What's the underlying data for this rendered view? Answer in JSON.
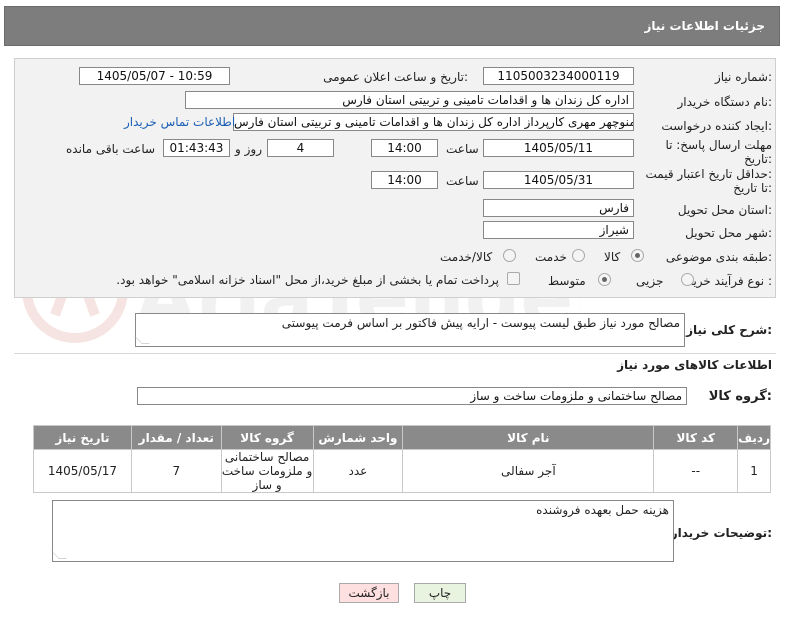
{
  "header": {
    "title": "جزئیات اطلاعات نیاز"
  },
  "fields": {
    "need_number_label": "شماره نیاز:",
    "need_number": "1105003234000119",
    "announce_label": "تاریخ و ساعت اعلان عمومی:",
    "announce_value": "1405/05/07 - 10:59",
    "buyer_label": "نام دستگاه خریدار:",
    "buyer_value": "اداره کل زندان ها و اقدامات تامینی و تربیتی استان فارس",
    "creator_label": "ایجاد کننده درخواست:",
    "creator_value": "منوچهر  مهری  کارپرداز اداره کل زندان ها و اقدامات تامینی و تربیتی استان فارس",
    "contact_link": "اطلاعات تماس خریدار",
    "deadline_label_1": "مهلت ارسال پاسخ: تا",
    "deadline_label_2": "تاریخ:",
    "deadline_date": "1405/05/11",
    "time_label": "ساعت",
    "deadline_time": "14:00",
    "days_value": "4",
    "days_label": "روز و",
    "remaining_time": "01:43:43",
    "remaining_label": "ساعت باقی مانده",
    "validity_label_1": "حداقل تاریخ اعتبار قیمت:",
    "validity_label_2": "تا تاریخ:",
    "validity_date": "1405/05/31",
    "validity_time": "14:00",
    "province_label": "استان محل تحویل:",
    "province_value": "فارس",
    "city_label": "شهر محل تحویل:",
    "city_value": "شیراز",
    "category_label": "طبقه بندی موضوعی:",
    "category_options": [
      "کالا",
      "خدمت",
      "کالا/خدمت"
    ],
    "category_selected": "کالا",
    "process_label": "نوع فرآیند خرید :",
    "process_options": [
      "جزیی",
      "متوسط"
    ],
    "process_selected": "متوسط",
    "payment_note": "پرداخت تمام یا بخشی از مبلغ خرید،از محل \"اسناد خزانه اسلامی\" خواهد بود."
  },
  "description": {
    "label": "شرح کلی نیاز:",
    "value": "مصالح مورد نیاز طبق لیست پیوست - ارایه پیش فاکتور بر اساس فرمت پیوستی"
  },
  "goods": {
    "section_title": "اطلاعات کالاهای مورد نیاز",
    "group_label": "گروه کالا:",
    "group_value": "مصالح ساختمانی و ملزومات ساخت و ساز",
    "columns": [
      "ردیف",
      "کد کالا",
      "نام کالا",
      "واحد شمارش",
      "گروه کالا",
      "تعداد / مقدار",
      "تاریخ نیاز"
    ],
    "rows": [
      [
        "1",
        "--",
        "آجر سفالی",
        "عدد",
        "مصالح ساختمانی و ملزومات ساخت و ساز",
        "7",
        "1405/05/17"
      ]
    ]
  },
  "buyer_notes": {
    "label": "توضیحات خریدار:",
    "value": "هزینه حمل بعهده فروشنده"
  },
  "buttons": {
    "print": "چاپ",
    "back": "بازگشت"
  },
  "watermark": {
    "text": "AriaTender.neT"
  },
  "colors": {
    "header_bg": "#7d7d7d",
    "panel_bg": "#f2f2f2",
    "table_header": "#8a8a8a",
    "link": "#1a5fb4",
    "back_button": "#ffe0e0",
    "print_button": "#e8f4e0"
  }
}
